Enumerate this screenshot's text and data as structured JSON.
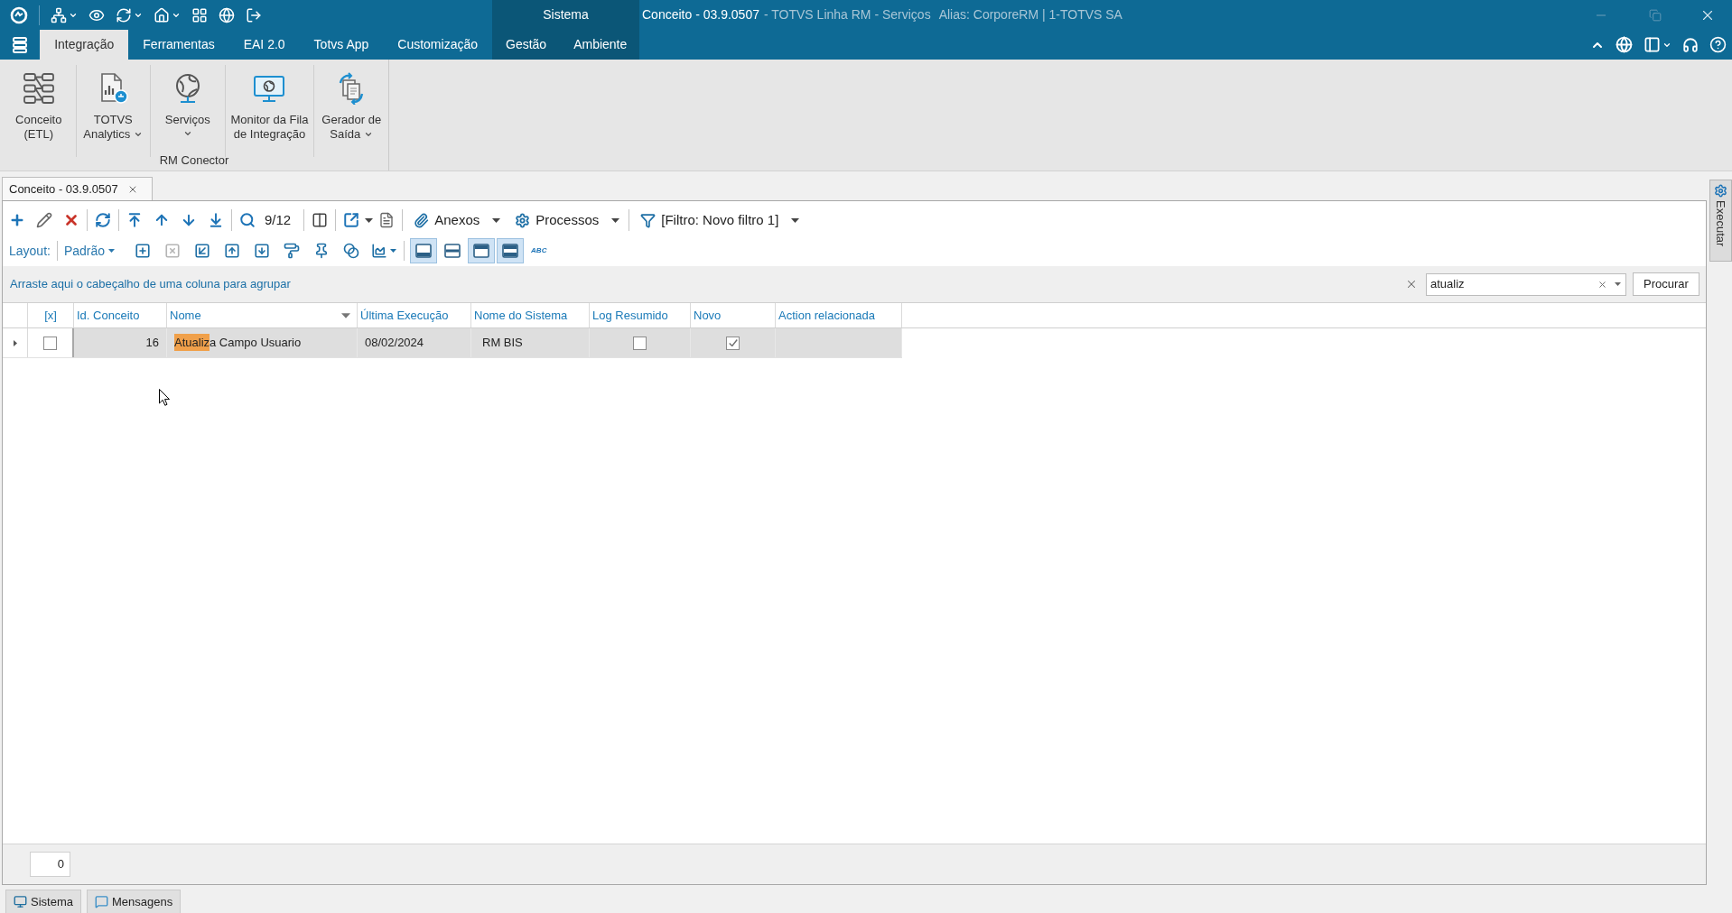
{
  "title_bar": {
    "document": "Conceito - 03.9.0507",
    "product": "- TOTVS Linha RM - Serviços",
    "alias": "Alias: CorporeRM | 1-TOTVS SA"
  },
  "ribbon_tabs": [
    {
      "label": "Integração",
      "selected": true
    },
    {
      "label": "Ferramentas",
      "selected": false
    },
    {
      "label": "EAI 2.0",
      "selected": false
    },
    {
      "label": "Totvs App",
      "selected": false
    },
    {
      "label": "Customização",
      "selected": false
    }
  ],
  "context_group": {
    "label": "Sistema",
    "tabs": [
      {
        "label": "Gestão",
        "selected": false
      },
      {
        "label": "Ambiente",
        "selected": false
      }
    ]
  },
  "ribbon": {
    "group": "RM Conector",
    "buttons": [
      {
        "kind": "etl",
        "lines": [
          "Conceito",
          "(ETL)"
        ],
        "dropdown": false
      },
      {
        "kind": "analytics",
        "lines": [
          "TOTVS",
          "Analytics"
        ],
        "dropdown": true
      },
      {
        "kind": "services",
        "lines": [
          "Serviços"
        ],
        "dropdown": true
      },
      {
        "kind": "monitor",
        "lines": [
          "Monitor da Fila",
          "de Integração"
        ],
        "dropdown": false
      },
      {
        "kind": "generator",
        "lines": [
          "Gerador de",
          "Saída"
        ],
        "dropdown": true
      }
    ]
  },
  "document_tabs": [
    {
      "label": "Conceito - 03.9.0507",
      "selected": true
    }
  ],
  "toolbar": {
    "record_counter": "9/12",
    "menus": [
      {
        "kind": "attachments",
        "label": "Anexos"
      },
      {
        "kind": "processes",
        "label": "Processos"
      },
      {
        "kind": "filter",
        "label": "[Filtro: Novo filtro 1]"
      }
    ]
  },
  "layout_bar": {
    "label": "Layout:",
    "layout": "Padrão",
    "view_toggles": [
      {
        "kind": "bottom",
        "selected": true
      },
      {
        "kind": "rows",
        "selected": false
      },
      {
        "kind": "top",
        "selected": true
      },
      {
        "kind": "both",
        "selected": true
      }
    ],
    "spelling": "ABC"
  },
  "group_panel": {
    "hint": "Arraste aqui o cabeçalho de uma coluna para agrupar"
  },
  "search": {
    "value": "atualiz",
    "button": "Procurar"
  },
  "table": {
    "columns": [
      {
        "label": "[x]",
        "filter_button": false
      },
      {
        "label": "Id. Conceito",
        "filter_button": false
      },
      {
        "label": "Nome",
        "filter_button": true
      },
      {
        "label": "Última Execução",
        "filter_button": false
      },
      {
        "label": "Nome do Sistema",
        "filter_button": false
      },
      {
        "label": "Log Resumido",
        "filter_button": false
      },
      {
        "label": "Novo",
        "filter_button": false
      },
      {
        "label": "Action relacionada",
        "filter_button": false
      }
    ],
    "rows": [
      {
        "selected": true,
        "checked": false,
        "id": "16",
        "name": {
          "match": "Atualiz",
          "rest": "a Campo Usuario"
        },
        "last_run": "08/02/2024",
        "system": "RM BIS",
        "log_summary": false,
        "new": true
      }
    ]
  },
  "footer": {
    "count": "0"
  },
  "side_panel": {
    "label": "Executar"
  },
  "bottom_tabs": [
    {
      "kind": "system",
      "label": "Sistema"
    },
    {
      "kind": "messages",
      "label": "Mensagens"
    }
  ]
}
